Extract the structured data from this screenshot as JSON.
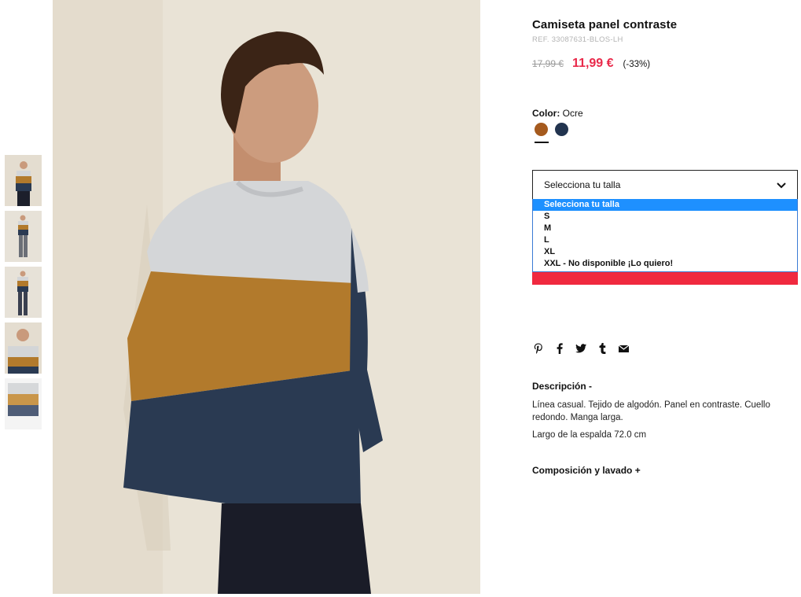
{
  "product": {
    "title": "Camiseta panel contraste",
    "ref": "REF. 33087631-BLOS-LH",
    "old_price": "17,99 €",
    "new_price": "11,99 €",
    "discount": "(-33%)"
  },
  "color": {
    "label": "Color:",
    "selected_name": "Ocre",
    "swatches": [
      {
        "name": "Ocre",
        "hex": "#a55a1e"
      },
      {
        "name": "Navy",
        "hex": "#22344f"
      }
    ]
  },
  "size_select": {
    "current_value": "Selecciona tu talla",
    "options": [
      "Selecciona tu talla",
      "S",
      "M",
      "L",
      "XL",
      "XXL - No disponible ¡Lo quiero!"
    ]
  },
  "share_icons": [
    "pinterest-icon",
    "facebook-icon",
    "twitter-icon",
    "tumblr-icon",
    "email-icon"
  ],
  "description": {
    "heading": "Descripción -",
    "text": "Línea casual. Tejido de algodón. Panel en contraste. Cuello redondo. Manga larga.",
    "length": "Largo de la espalda 72.0 cm"
  },
  "composition": {
    "heading": "Composición y lavado +"
  },
  "colors": {
    "accent_red": "#f0293f",
    "price_red": "#e9294a",
    "dropdown_highlight": "#1e90ff"
  }
}
